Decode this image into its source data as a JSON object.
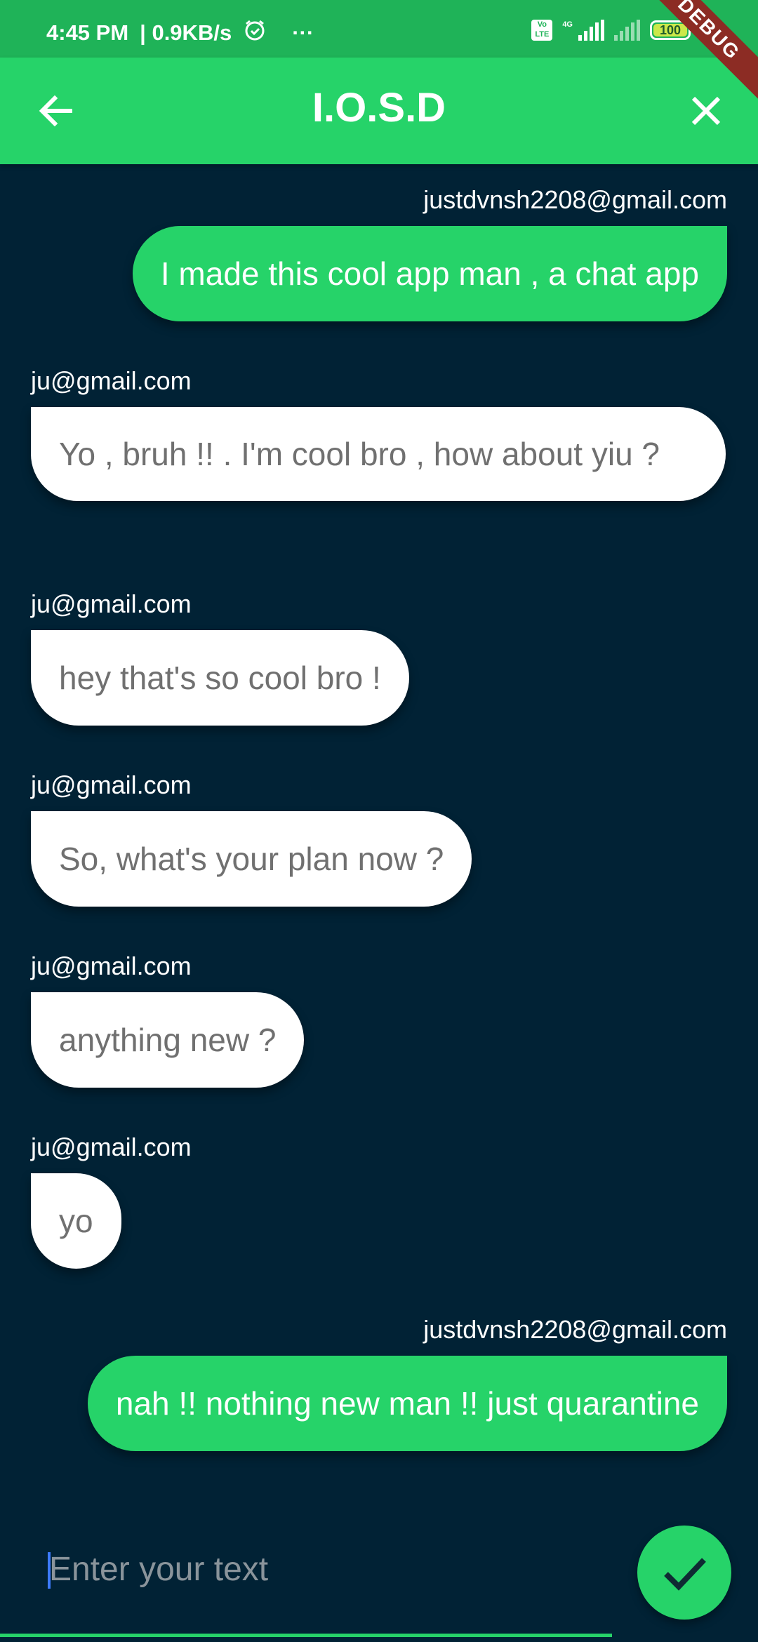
{
  "status_bar": {
    "time": "4:45 PM",
    "speed": "| 0.9KB/s",
    "more": "···",
    "volte": "Vo LTE",
    "network": "4G",
    "battery_text": "100",
    "battery_level": 1.0
  },
  "debug_banner": "DEBUG",
  "app_bar": {
    "title": "I.O.S.D",
    "back_icon": "arrow-back-icon",
    "close_icon": "close-icon"
  },
  "messages": [
    {
      "sender": "justdvnsh2208@gmail.com",
      "text": "I made this cool app man , a chat app",
      "mine": true
    },
    {
      "sender": "ju@gmail.com",
      "text": "Yo , bruh !! . I'm cool bro , how about yiu ?",
      "mine": false
    },
    {
      "sender": "ju@gmail.com",
      "text": "hey that's so cool bro !",
      "mine": false
    },
    {
      "sender": "ju@gmail.com",
      "text": "So, what's your plan now ?",
      "mine": false
    },
    {
      "sender": "ju@gmail.com",
      "text": "anything new ?",
      "mine": false
    },
    {
      "sender": "ju@gmail.com",
      "text": "yo",
      "mine": false
    },
    {
      "sender": "justdvnsh2208@gmail.com",
      "text": "nah !! nothing new man !! just quarantine",
      "mine": true
    }
  ],
  "composer": {
    "placeholder": "Enter your text",
    "value": "",
    "send_icon": "check-icon"
  },
  "colors": {
    "background": "#012235",
    "accent": "#26d369",
    "status_bar": "#1fb358",
    "their_bubble": "#ffffff",
    "their_text": "#707070"
  }
}
